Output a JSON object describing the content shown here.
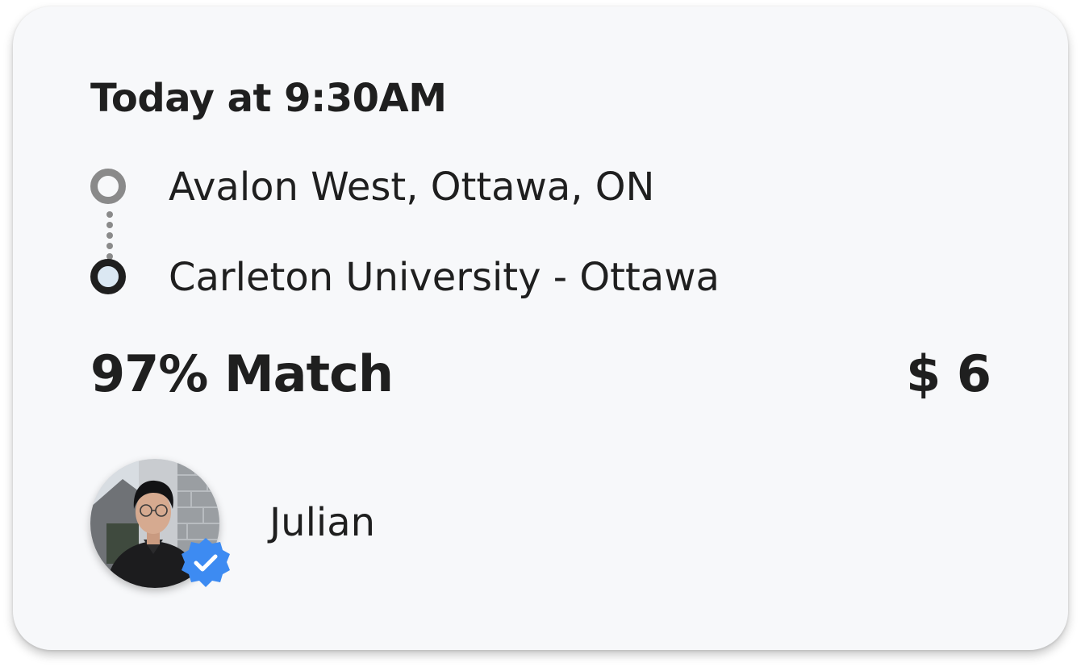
{
  "ride": {
    "time": "Today at 9:30AM",
    "origin": "Avalon West, Ottawa, ON",
    "destination": "Carleton University - Ottawa",
    "match": "97% Match",
    "price": "$ 6"
  },
  "rider": {
    "name": "Julian",
    "verified": true,
    "verified_badge_color": "#3d8bf2"
  },
  "colors": {
    "card_background": "#f7f8fa",
    "text": "#1f1f1f",
    "origin_marker": "#8a8a8a",
    "destination_marker": "#1f1f1f",
    "destination_marker_fill": "#dbe8f3"
  },
  "icons": {
    "origin": "origin-ring-icon",
    "destination": "destination-ring-icon",
    "route": "dotted-route-icon",
    "verified": "verified-badge-icon"
  }
}
